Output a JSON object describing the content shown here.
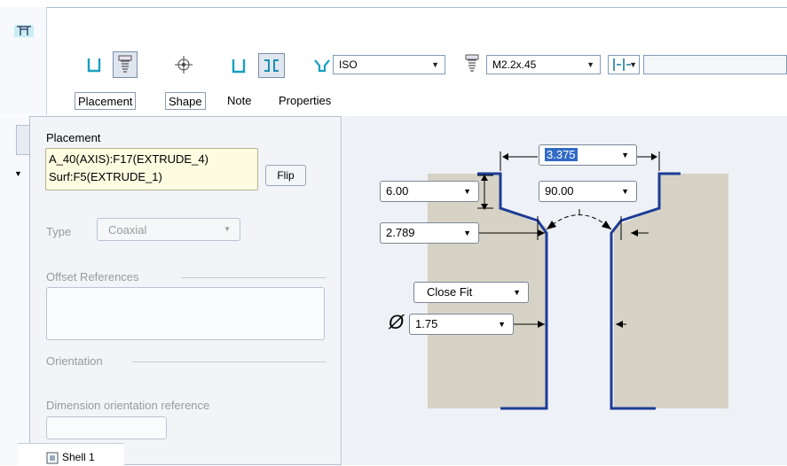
{
  "toolbar": {
    "standard_value": "ISO",
    "screw_size_value": "M2.2x.45"
  },
  "tabs": {
    "placement": "Placement",
    "shape": "Shape",
    "note": "Note",
    "properties": "Properties"
  },
  "panel": {
    "placement_title": "Placement",
    "placement_ref_1": "A_40(AXIS):F17(EXTRUDE_4)",
    "placement_ref_2": "Surf:F5(EXTRUDE_1)",
    "flip_label": "Flip",
    "type_label": "Type",
    "type_value": "Coaxial",
    "offset_refs_label": "Offset References",
    "orientation_label": "Orientation",
    "dim_orient_label": "Dimension orientation reference",
    "shell_label": "Shell 1"
  },
  "shape": {
    "top_diameter": "3.375",
    "depth": "6.00",
    "angle": "90.00",
    "cbore_diameter": "2.789",
    "fit": "Close Fit",
    "hole_diameter": "1.75",
    "diameter_symbol": "Ø"
  },
  "colors": {
    "profile": "#1e3c96",
    "material": "#d6d3c6",
    "highlight": "#fdfbe0",
    "selection": "#316ac5"
  }
}
